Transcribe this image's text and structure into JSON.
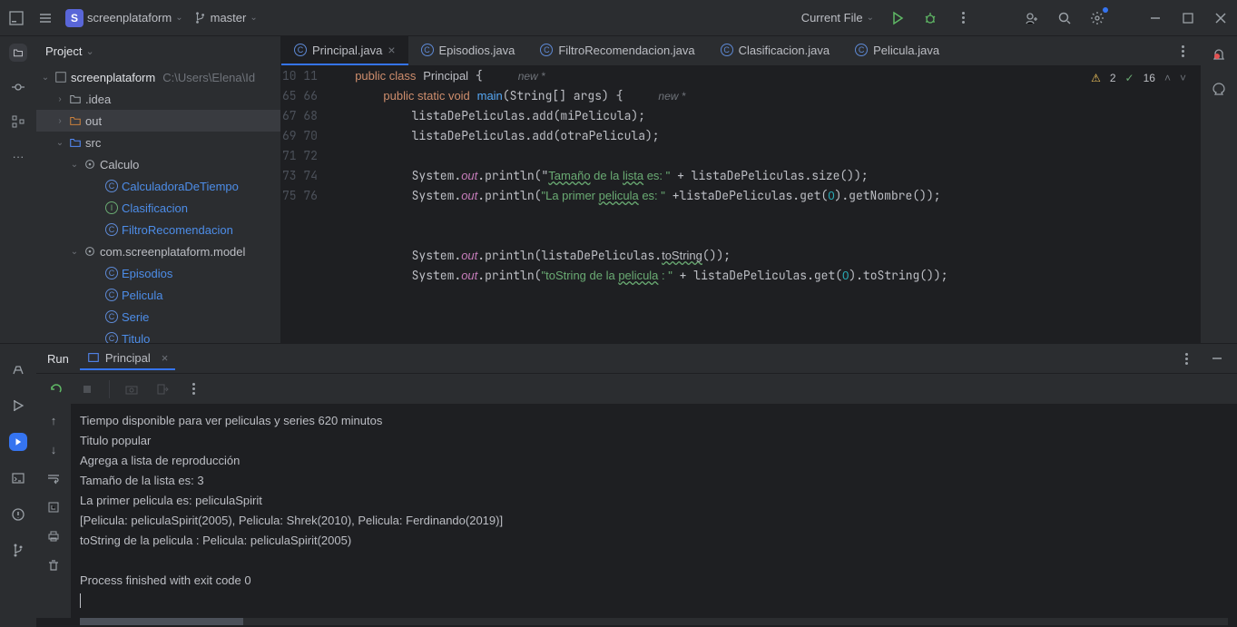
{
  "topbar": {
    "project_letter": "S",
    "project_name": "screenplataform",
    "branch_name": "master",
    "run_config": "Current File"
  },
  "projectPanel": {
    "title": "Project",
    "root_name": "screenplataform",
    "root_path": "C:\\Users\\Elena\\Id",
    "items": [
      {
        "indent": 16,
        "chev": "›",
        "icon": "folder",
        "name": ".idea"
      },
      {
        "indent": 16,
        "chev": "›",
        "icon": "folder-orange",
        "name": "out"
      },
      {
        "indent": 16,
        "chev": "⌄",
        "icon": "folder-blue",
        "name": "src"
      },
      {
        "indent": 32,
        "chev": "⌄",
        "icon": "pkg",
        "name": "Calculo"
      },
      {
        "indent": 56,
        "chev": "",
        "icon": "class",
        "name": "CalculadoraDeTiempo",
        "link": true
      },
      {
        "indent": 56,
        "chev": "",
        "icon": "interface",
        "name": "Clasificacion",
        "link": true
      },
      {
        "indent": 56,
        "chev": "",
        "icon": "class",
        "name": "FiltroRecomendacion",
        "link": true
      },
      {
        "indent": 32,
        "chev": "⌄",
        "icon": "pkg",
        "name": "com.screenplataform.model"
      },
      {
        "indent": 56,
        "chev": "",
        "icon": "class",
        "name": "Episodios",
        "link": true
      },
      {
        "indent": 56,
        "chev": "",
        "icon": "class",
        "name": "Pelicula",
        "link": true
      },
      {
        "indent": 56,
        "chev": "",
        "icon": "class",
        "name": "Serie",
        "link": true
      },
      {
        "indent": 56,
        "chev": "",
        "icon": "class",
        "name": "Titulo",
        "link": true
      }
    ]
  },
  "tabs": [
    {
      "name": "Principal.java",
      "active": true
    },
    {
      "name": "Episodios.java"
    },
    {
      "name": "FiltroRecomendacion.java"
    },
    {
      "name": "Clasificacion.java"
    },
    {
      "name": "Pelicula.java"
    }
  ],
  "editor": {
    "warnings": "2",
    "authors": "16",
    "hint_new": "new *",
    "lines": [
      {
        "n": "10",
        "t": "    public class Principal {",
        "classDecl": true
      },
      {
        "n": "11",
        "t": "        public static void main(String[] args) {",
        "mainDecl": true
      },
      {
        "n": "65",
        "seg": [
          {
            "t": "            listaDePeliculas.add(miPelicula);"
          }
        ]
      },
      {
        "n": "66",
        "seg": [
          {
            "t": "            listaDePeliculas.add(otraPelicula);"
          }
        ]
      },
      {
        "n": "67",
        "seg": [
          {
            "t": ""
          }
        ]
      },
      {
        "n": "68",
        "seg": [
          {
            "t": "            System."
          },
          {
            "t": "out",
            "c": "field"
          },
          {
            "t": ".println("
          },
          {
            "t": "\""
          },
          {
            "t": "Tamaño",
            "c": "str err-underline"
          },
          {
            "t": " de la ",
            "c": "str"
          },
          {
            "t": "lista",
            "c": "str err-underline"
          },
          {
            "t": " es: \"",
            "c": "str"
          },
          {
            "t": " + listaDePeliculas.size());"
          }
        ]
      },
      {
        "n": "69",
        "seg": [
          {
            "t": "            System."
          },
          {
            "t": "out",
            "c": "field"
          },
          {
            "t": ".println("
          },
          {
            "t": "\"La primer ",
            "c": "str"
          },
          {
            "t": "pelicula",
            "c": "str err-underline"
          },
          {
            "t": " es: \"",
            "c": "str"
          },
          {
            "t": " +listaDePeliculas.get("
          },
          {
            "t": "0",
            "c": "num"
          },
          {
            "t": ").getNombre());"
          }
        ]
      },
      {
        "n": "70",
        "seg": [
          {
            "t": ""
          }
        ]
      },
      {
        "n": "71",
        "seg": [
          {
            "t": ""
          }
        ]
      },
      {
        "n": "72",
        "seg": [
          {
            "t": "            System."
          },
          {
            "t": "out",
            "c": "field"
          },
          {
            "t": ".println(listaDePeliculas."
          },
          {
            "t": "toString",
            "c": "err-underline"
          },
          {
            "t": "());"
          }
        ]
      },
      {
        "n": "73",
        "seg": [
          {
            "t": "            System."
          },
          {
            "t": "out",
            "c": "field"
          },
          {
            "t": ".println("
          },
          {
            "t": "\"toString de la ",
            "c": "str"
          },
          {
            "t": "pelicula",
            "c": "str err-underline"
          },
          {
            "t": " : \"",
            "c": "str"
          },
          {
            "t": " + listaDePeliculas.get("
          },
          {
            "t": "0",
            "c": "num"
          },
          {
            "t": ").toString());"
          }
        ]
      },
      {
        "n": "74",
        "seg": [
          {
            "t": ""
          }
        ]
      },
      {
        "n": "75",
        "seg": [
          {
            "t": ""
          }
        ]
      },
      {
        "n": "76",
        "seg": [
          {
            "t": ""
          }
        ]
      }
    ]
  },
  "run": {
    "title": "Run",
    "tab_name": "Principal",
    "output": "Tiempo disponible para ver peliculas y series 620 minutos\nTitulo popular\nAgrega a lista de reproducción\nTamaño de la lista es: 3\nLa primer pelicula es: peliculaSpirit\n[Pelicula: peliculaSpirit(2005), Pelicula: Shrek(2010), Pelicula: Ferdinando(2019)]\ntoString de la pelicula : Pelicula: peliculaSpirit(2005)\n\nProcess finished with exit code 0"
  }
}
